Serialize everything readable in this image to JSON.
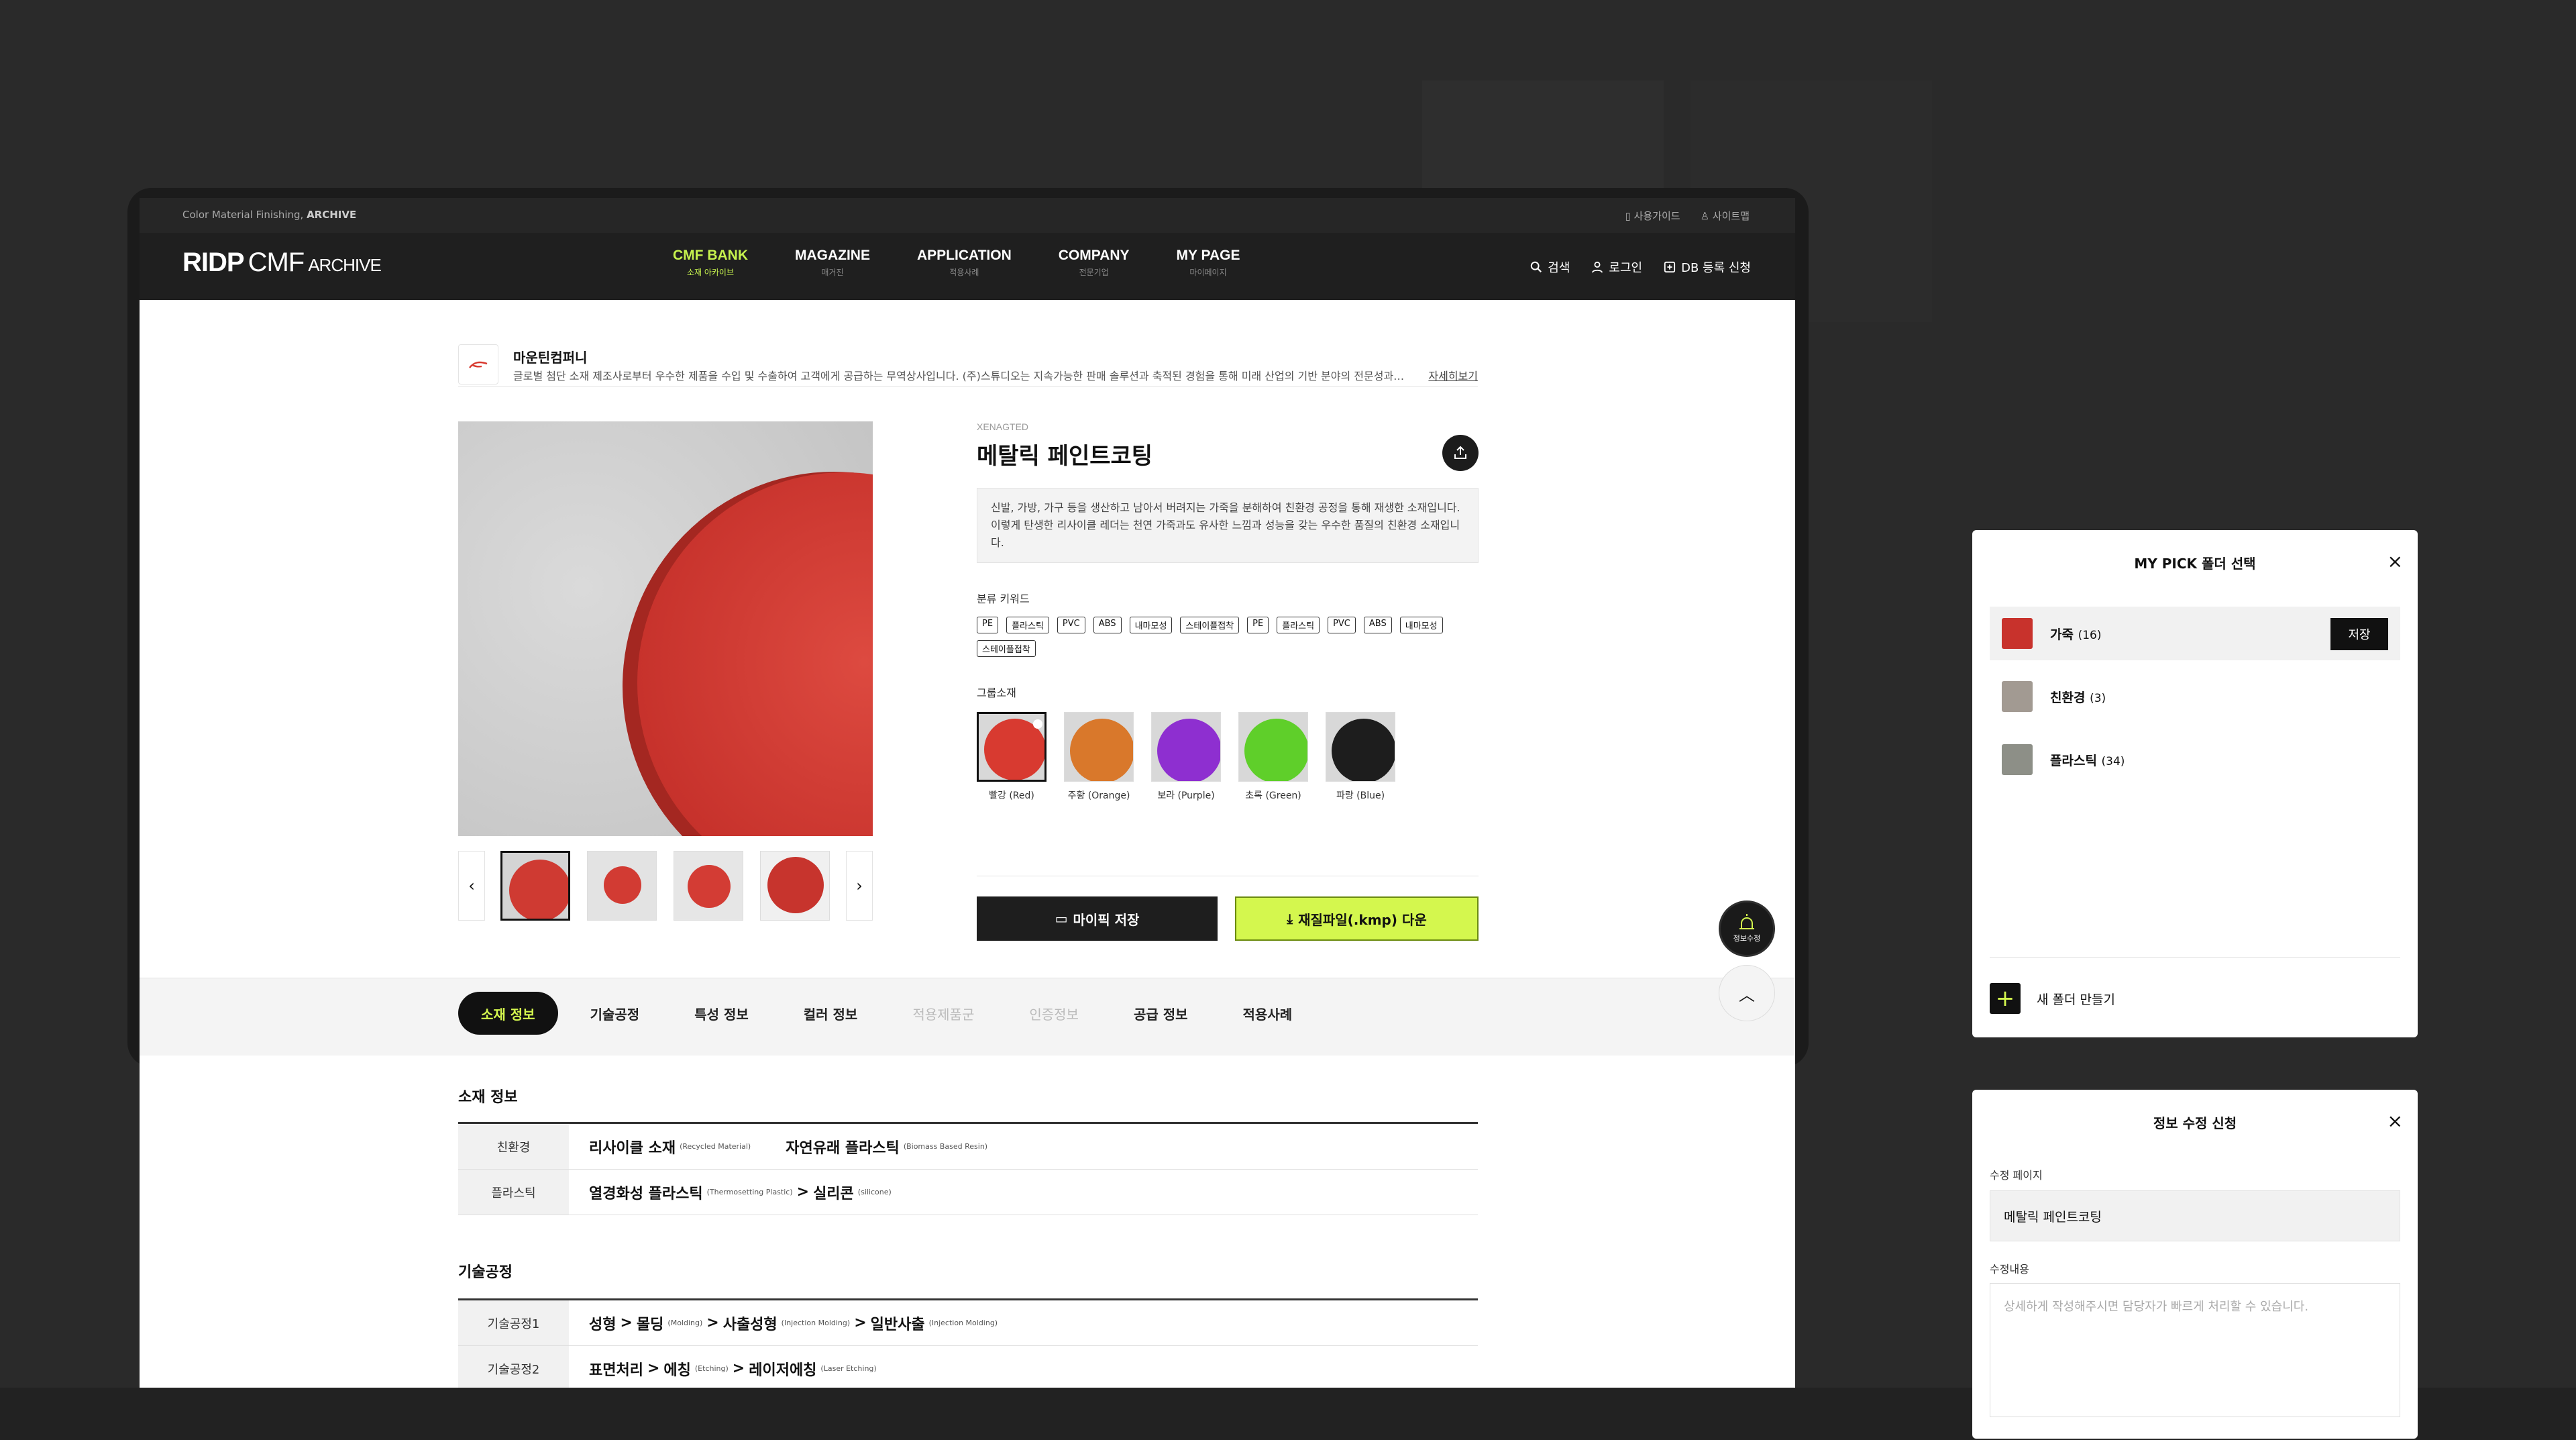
{
  "topbar": {
    "left_text": "Color Material Finishing, ",
    "left_bold": "ARCHIVE",
    "guide": "사용가이드",
    "sitemap": "사이트맵"
  },
  "logo": {
    "ridp": "RIDP",
    "cmf": "CMF",
    "archive": "ARCHIVE"
  },
  "nav": [
    {
      "label": "CMF BANK",
      "sub": "소재 아카이브",
      "active": true
    },
    {
      "label": "MAGAZINE",
      "sub": "매거진"
    },
    {
      "label": "APPLICATION",
      "sub": "적용사례"
    },
    {
      "label": "COMPANY",
      "sub": "전문기업"
    },
    {
      "label": "MY PAGE",
      "sub": "마이페이지"
    }
  ],
  "header_actions": {
    "search": "검색",
    "login": "로그인",
    "db": "DB 등록 신청"
  },
  "company": {
    "name": "마운틴컴퍼니",
    "desc": "글로벌 첨단 소재 제조사로부터 우수한 제품을 수입 및 수출하여 고객에게 공급하는 무역상사입니다. (주)스튜디오는 지속가능한 판매 솔루션과 축적된 경험을 통해 미래 산업의 기반 분야의 전문성과 책임을 갖춘 기업입니다.",
    "more": "자세히보기"
  },
  "product": {
    "sub": "XENAGTED",
    "title": "메탈릭 페인트코팅",
    "desc": "신발, 가방, 가구 등을 생산하고 남아서 버려지는 가죽을 분해하여 친환경 공정을 통해 재생한 소재입니다. 이렇게 탄생한 리사이클 레더는 천연 가죽과도 유사한 느낌과 성능을 갖는 우수한 품질의 친환경 소재입니다.",
    "kw_label": "분류 키워드",
    "keywords": [
      "PE",
      "플라스틱",
      "PVC",
      "ABS",
      "내마모성",
      "스테이플접착",
      "PE",
      "플라스틱",
      "PVC",
      "ABS",
      "내마모성",
      "스테이플접착"
    ],
    "group_label": "그룹소재",
    "group": [
      {
        "name": "빨강 (Red)",
        "color": "#d83a30",
        "active": true
      },
      {
        "name": "주황 (Orange)",
        "color": "#d9782b"
      },
      {
        "name": "보라 (Purple)",
        "color": "#8e2fd0"
      },
      {
        "name": "초록 (Green)",
        "color": "#5fcf2a"
      },
      {
        "name": "파랑 (Blue)",
        "color": "#1d1d1d"
      }
    ],
    "btn_save": "마이픽 저장",
    "btn_download": "재질파일(.kmp) 다운",
    "main_color": "#d5403a"
  },
  "tabs": [
    {
      "label": "소재 정보",
      "state": "on"
    },
    {
      "label": "기술공정"
    },
    {
      "label": "특성 정보"
    },
    {
      "label": "컬러 정보"
    },
    {
      "label": "적용제품군",
      "state": "dis"
    },
    {
      "label": "인증정보",
      "state": "dis"
    },
    {
      "label": "공급 정보"
    },
    {
      "label": "적용사례"
    }
  ],
  "fab": {
    "label": "정보수정"
  },
  "material": {
    "title": "소재 정보",
    "rows": [
      {
        "th": "친환경",
        "a": "리사이클 소재",
        "a_en": "(Recycled Material)",
        "b": "자연유래 플라스틱",
        "b_en": "(Biomass Based Resin)"
      },
      {
        "th": "플라스틱",
        "a": "열경화성 플라스틱",
        "a_en": "(Thermosetting Plastic)",
        "sep": ">",
        "b": "실리콘",
        "b_en": "(silicone)"
      }
    ]
  },
  "process": {
    "title": "기술공정",
    "rows": [
      {
        "th": "기술공정1",
        "p1": "성형",
        "sep1": ">",
        "p2": "몰딩",
        "p2_en": "(Molding)",
        "sep2": ">",
        "p3": "사출성형",
        "p3_en": "(Injection Molding)",
        "sep3": ">",
        "p4": "일반사출",
        "p4_en": "(Injection Molding)"
      },
      {
        "th": "기술공정2",
        "p1": "표면처리",
        "sep1": ">",
        "p2": "에칭",
        "p2_en": "(Etching)",
        "sep2": ">",
        "p3": "레이저에칭",
        "p3_en": "(Laser Etching)"
      }
    ]
  },
  "mypick": {
    "title": "MY PICK 폴더 선택",
    "folders": [
      {
        "name": "가죽",
        "count": "(16)",
        "color": "#c8322c",
        "active": true
      },
      {
        "name": "친환경",
        "count": "(3)",
        "color": "#a29a92"
      },
      {
        "name": "플라스틱",
        "count": "(34)",
        "color": "#8d8f87"
      }
    ],
    "save": "저장",
    "new": "새 폴더 만들기"
  },
  "edit": {
    "title": "정보 수정 신청",
    "page_label": "수정 페이지",
    "page_value": "메탈릭 페인트코팅",
    "content_label": "수정내용",
    "placeholder": "상세하게 작성해주시면 담당자가 빠르게 처리할 수 있습니다."
  }
}
